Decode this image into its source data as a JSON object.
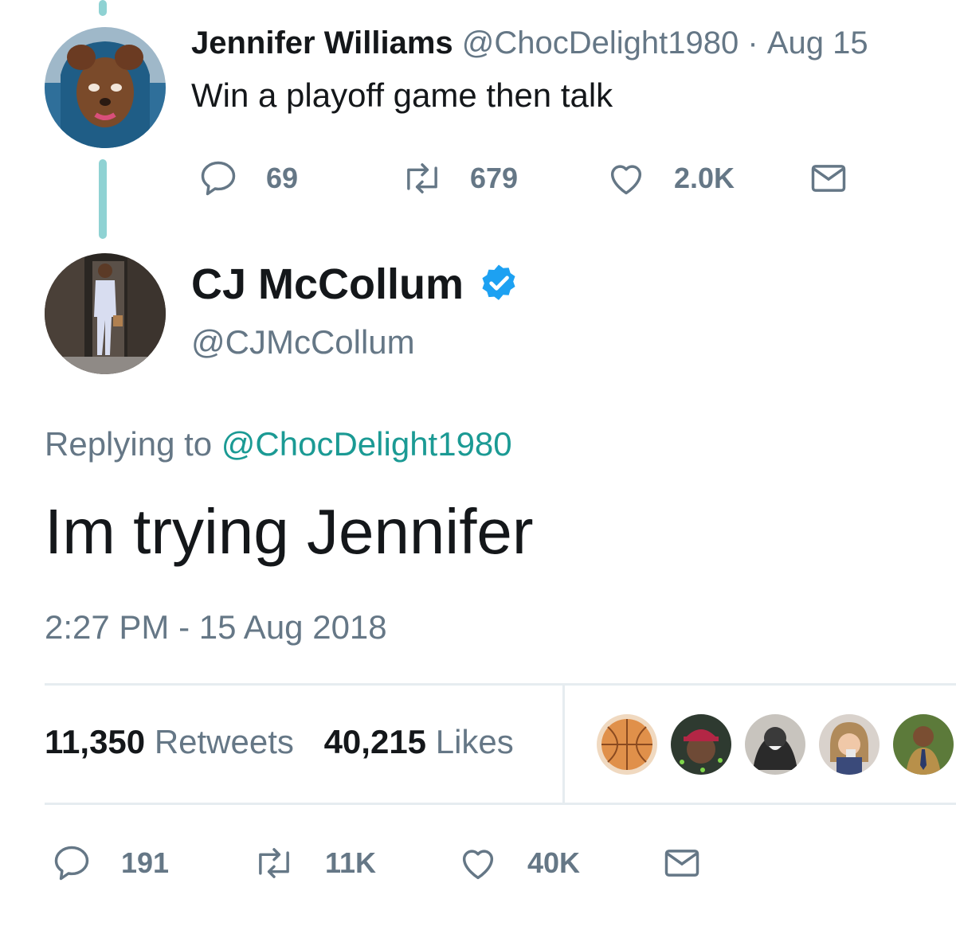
{
  "parent_tweet": {
    "name": "Jennifer Williams",
    "handle": "@ChocDelight1980",
    "separator": "·",
    "date": "Aug 15",
    "text": "Win a playoff game then talk",
    "replies": "69",
    "retweets": "679",
    "likes": "2.0K"
  },
  "main_tweet": {
    "name": "CJ McCollum",
    "verified": true,
    "handle": "@CJMcCollum",
    "replying_prefix": "Replying to",
    "replying_handle": "@ChocDelight1980",
    "text": "Im trying Jennifer",
    "timestamp": "2:27 PM - 15 Aug 2018",
    "retweet_count": "11,350",
    "retweet_label": "Retweets",
    "like_count": "40,215",
    "like_label": "Likes",
    "replies": "191",
    "retweets": "11K",
    "likes": "40K"
  },
  "colors": {
    "accent_link": "#1b9a94",
    "verified": "#1da1f2",
    "muted_text": "#657786",
    "thread_line": "#8fd2d3"
  },
  "icons": [
    "reply-icon",
    "retweet-icon",
    "like-icon",
    "dm-icon",
    "verified-badge-icon"
  ]
}
